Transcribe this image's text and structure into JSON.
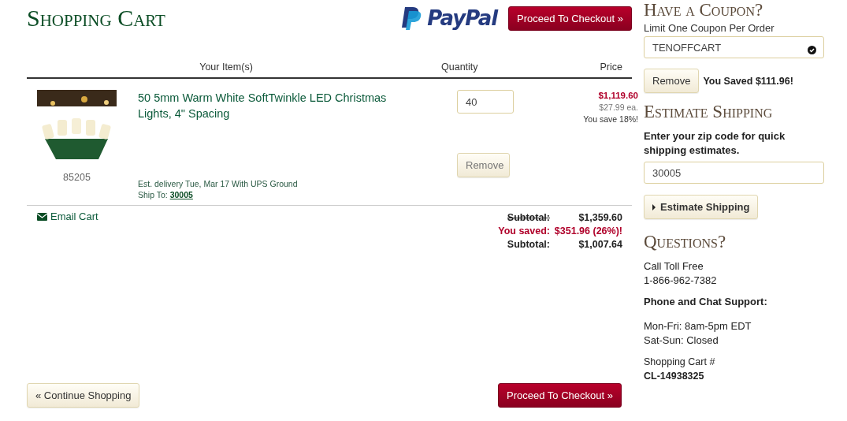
{
  "header": {
    "title": "Shopping Cart",
    "paypal_logo": "PayPal",
    "checkout_button": "Proceed To Checkout »"
  },
  "table": {
    "columns": [
      "Your Item(s)",
      "Quantity",
      "Price"
    ],
    "rows": [
      {
        "sku": "85205",
        "name": "50 5mm Warm White SoftTwinkle LED Christmas Lights, 4\" Spacing",
        "delivery": "Est. delivery Tue, Mar 17 With UPS Ground",
        "ship_to_label": "Ship To:",
        "ship_to_zip": "30005",
        "quantity": "40",
        "remove_button": "Remove",
        "price": "$1,119.60",
        "unit_price": "$27.99 ea.",
        "savings": "You save 18%!"
      }
    ]
  },
  "email_cart": "Email Cart",
  "totals": [
    {
      "kind": "struck",
      "label": "Subtotal:",
      "value": "$1,359.60"
    },
    {
      "kind": "saved",
      "label": "You saved:",
      "value": "$351.96 (26%)!"
    },
    {
      "kind": "final",
      "label": "Subtotal:",
      "value": "$1,007.64"
    }
  ],
  "footer": {
    "continue_button": "« Continue Shopping",
    "checkout_button": "Proceed To Checkout »"
  },
  "sidebar": {
    "coupon": {
      "title": "Have a Coupon?",
      "note": "Limit One Coupon Per Order",
      "code": "TENOFFCART",
      "applied": true,
      "remove_button": "Remove",
      "saved_note": "You Saved $111.96!"
    },
    "shipping": {
      "title": "Estimate Shipping",
      "prompt": "Enter your zip code for quick shipping estimates.",
      "zip": "30005",
      "button": "Estimate Shipping"
    },
    "questions": {
      "title": "Questions?",
      "toll_free_label": "Call Toll Free",
      "phone": "1-866-962-7382",
      "support_label": "Phone and Chat Support:",
      "hours": [
        "Mon-Fri: 8am-5pm EDT",
        "Sat-Sun: Closed"
      ],
      "cart_number_label": "Shopping Cart #",
      "cart_number": "CL-14938325"
    }
  }
}
